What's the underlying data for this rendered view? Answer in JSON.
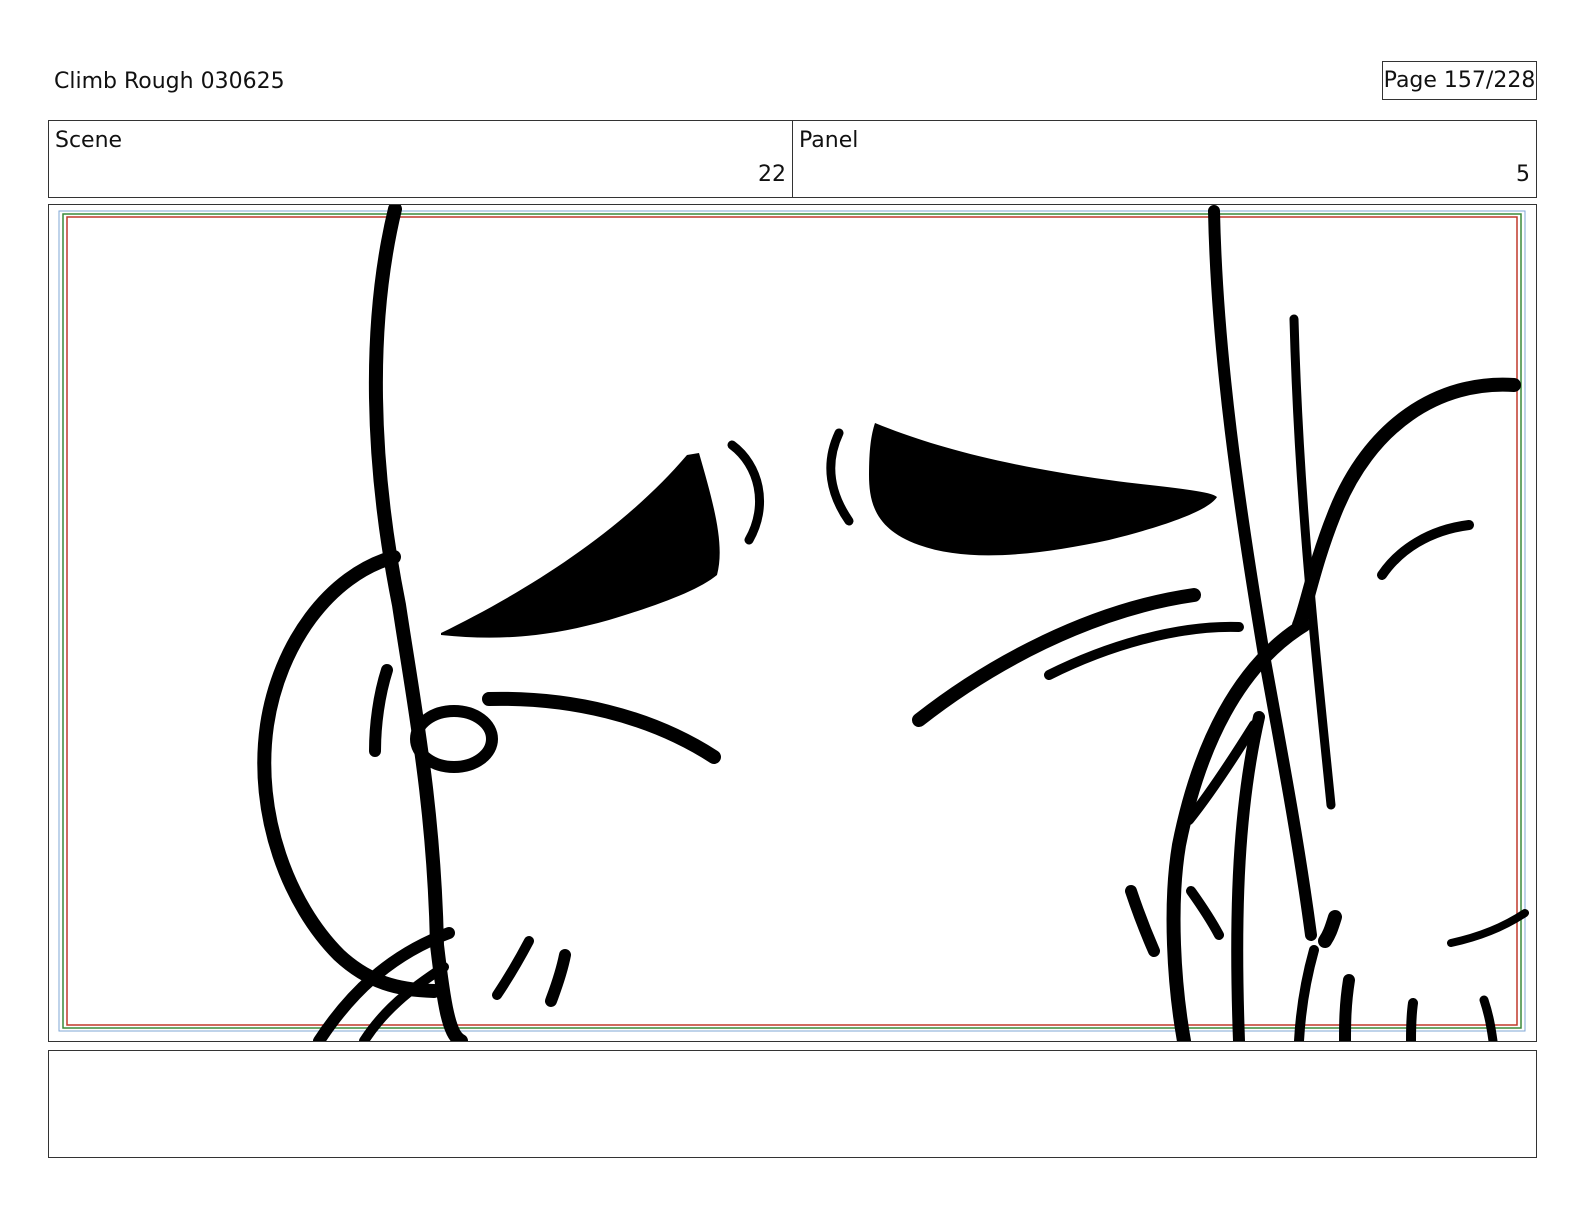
{
  "header": {
    "title": "Climb Rough 030625",
    "page": "Page 157/228"
  },
  "scene": {
    "label": "Scene",
    "value": "22"
  },
  "panel": {
    "label": "Panel",
    "value": "5"
  },
  "notes": {
    "text": ""
  },
  "colors": {
    "safe_frame_red": "#c0392b",
    "safe_frame_green": "#3a8a3a",
    "safe_frame_blue": "#7fa7d6",
    "ink": "#000000"
  }
}
